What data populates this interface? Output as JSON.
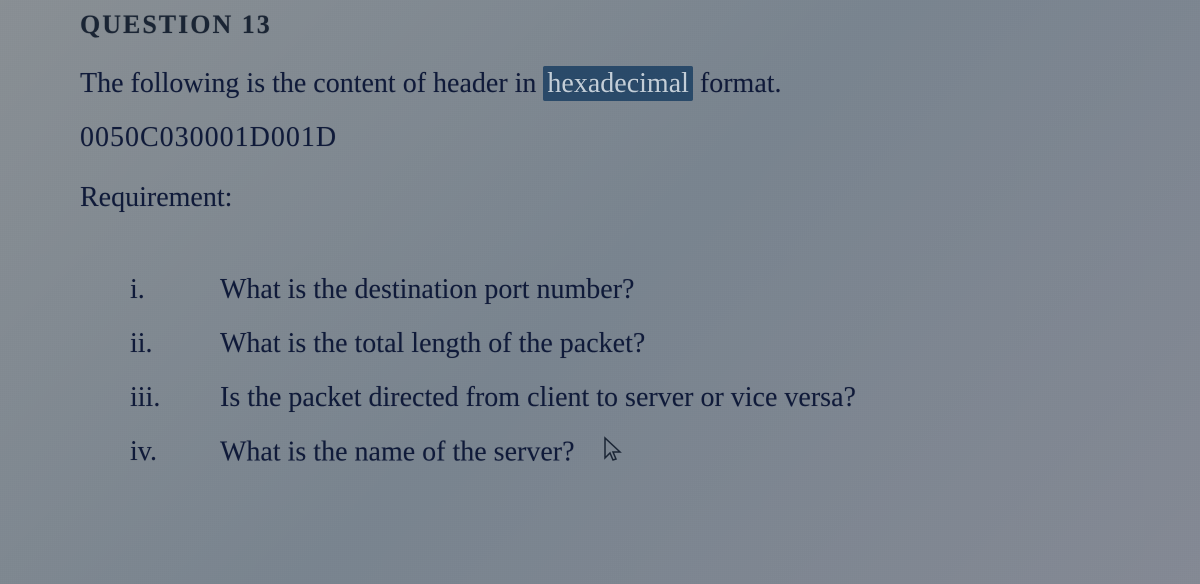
{
  "header": {
    "label": "QUESTION 13"
  },
  "intro": {
    "prefix": "The following is the content of header in ",
    "highlighted": "hexadecimal",
    "suffix": " format."
  },
  "hex": "0050C030001D001D",
  "requirement_label": "Requirement:",
  "questions": [
    {
      "numeral": "i.",
      "text": "What is the destination port number?"
    },
    {
      "numeral": "ii.",
      "text": "What is the total length of the packet?"
    },
    {
      "numeral": "iii.",
      "text": "Is the packet directed from client to server or vice versa?"
    },
    {
      "numeral": "iv.",
      "text": "What is the name of the server?"
    }
  ]
}
